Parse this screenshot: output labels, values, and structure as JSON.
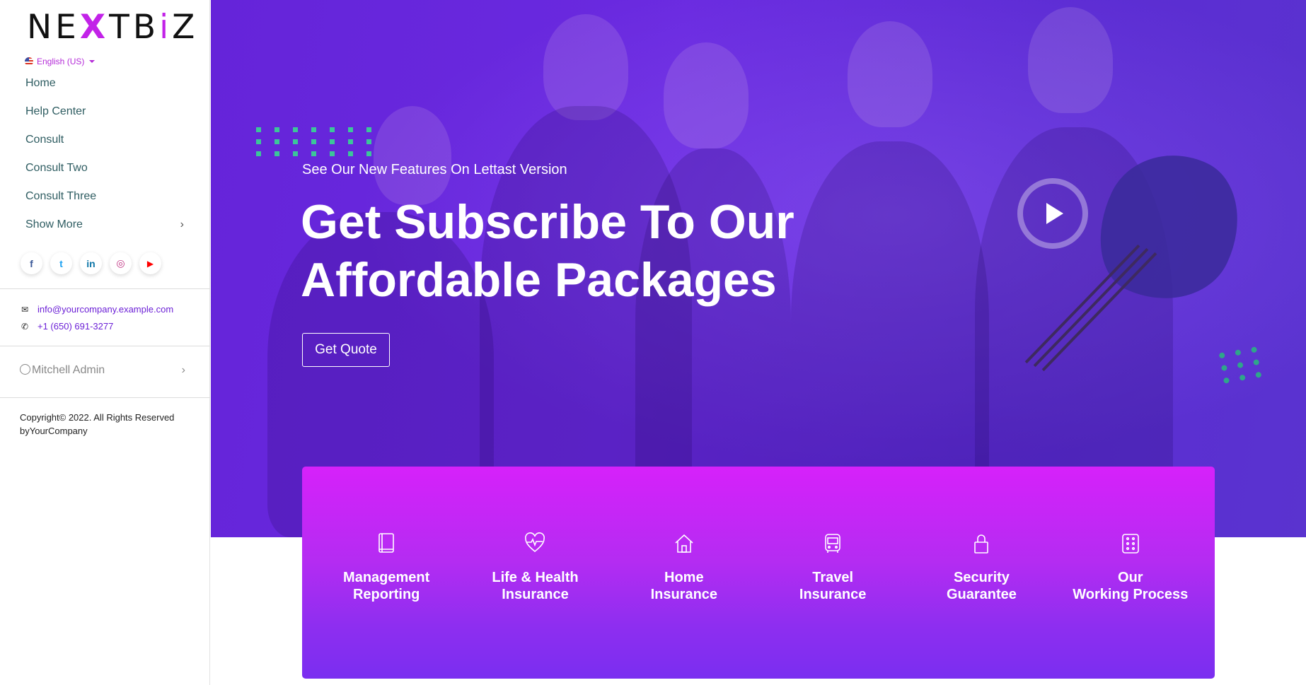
{
  "brand": {
    "logo_prefix": "NE",
    "logo_x": "X",
    "logo_mid": "TB",
    "logo_i": "i",
    "logo_suffix": "Z"
  },
  "language": {
    "label": "English (US)"
  },
  "nav": {
    "items": [
      {
        "label": "Home"
      },
      {
        "label": "Help Center"
      },
      {
        "label": "Consult"
      },
      {
        "label": "Consult Two"
      },
      {
        "label": "Consult Three"
      },
      {
        "label": "Show More",
        "chevron": "›"
      }
    ]
  },
  "social": [
    {
      "icon": "facebook-icon",
      "glyph": "f",
      "color": "#3b5998"
    },
    {
      "icon": "twitter-icon",
      "glyph": "t",
      "color": "#1da1f2"
    },
    {
      "icon": "linkedin-icon",
      "glyph": "in",
      "color": "#0e76a8"
    },
    {
      "icon": "instagram-icon",
      "glyph": "◎",
      "color": "#c13584"
    },
    {
      "icon": "youtube-icon",
      "glyph": "▶",
      "color": "#ff0000"
    }
  ],
  "contact": {
    "email": "info@yourcompany.example.com",
    "phone": "+1 (650) 691-3277"
  },
  "user": {
    "name": "Mitchell Admin",
    "chevron": "›"
  },
  "footer": {
    "copyright": "Copyright© 2022. All Rights Reserved byYourCompany"
  },
  "hero": {
    "eyebrow": "See Our New Features On Lettast Version",
    "headline_line1": "Get Subscribe To Our",
    "headline_line2": "Affordable Packages",
    "cta": "Get Quote"
  },
  "features": [
    {
      "icon": "book-icon",
      "line1": "Management",
      "line2": "Reporting"
    },
    {
      "icon": "heart-pulse-icon",
      "line1": "Life & Health",
      "line2": "Insurance"
    },
    {
      "icon": "home-icon",
      "line1": "Home",
      "line2": "Insurance"
    },
    {
      "icon": "bus-icon",
      "line1": "Travel",
      "line2": "Insurance"
    },
    {
      "icon": "lock-icon",
      "line1": "Security",
      "line2": "Guarantee"
    },
    {
      "icon": "dice-icon",
      "line1": "Our",
      "line2": "Working Process"
    }
  ],
  "colors": {
    "accent": "#c222e8",
    "hero": "#6524d9",
    "card_top": "#d621fa",
    "card_bottom": "#7a2ef0",
    "nav_text": "#2f5d62"
  }
}
